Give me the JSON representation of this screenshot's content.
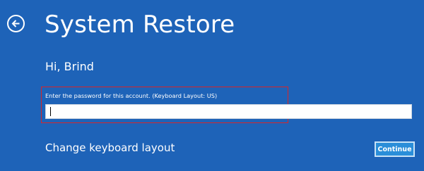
{
  "header": {
    "back_icon": "back-arrow-icon",
    "title": "System Restore"
  },
  "main": {
    "greeting": "Hi, Brind",
    "password_prompt": "Enter the password for this account. (Keyboard Layout: US)",
    "password_value": "",
    "change_keyboard_layout_label": "Change keyboard layout",
    "continue_label": "Continue"
  },
  "colors": {
    "background": "#1e63b8",
    "highlight_border": "#d6262a",
    "continue_button": "#2a8ed9"
  }
}
